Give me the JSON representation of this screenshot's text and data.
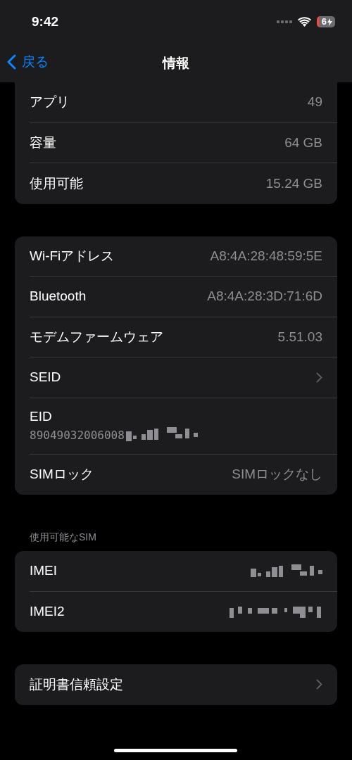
{
  "status_bar": {
    "time": "9:42",
    "battery": "6",
    "charging": true
  },
  "nav": {
    "back": "戻る",
    "title": "情報"
  },
  "groups": [
    {
      "rows": [
        {
          "kind": "value",
          "label": "アプリ",
          "value": "49"
        },
        {
          "kind": "value",
          "label": "容量",
          "value": "64 GB"
        },
        {
          "kind": "value",
          "label": "使用可能",
          "value": "15.24 GB"
        }
      ]
    },
    {
      "rows": [
        {
          "kind": "value",
          "label": "Wi-Fiアドレス",
          "value": "A8:4A:28:48:59:5E"
        },
        {
          "kind": "value",
          "label": "Bluetooth",
          "value": "A8:4A:28:3D:71:6D"
        },
        {
          "kind": "value",
          "label": "モデムファームウェア",
          "value": "5.51.03"
        },
        {
          "kind": "chevron",
          "label": "SEID"
        },
        {
          "kind": "stacked",
          "label": "EID",
          "value": "89049032006008"
        },
        {
          "kind": "value",
          "label": "SIMロック",
          "value": "SIMロックなし"
        }
      ]
    },
    {
      "header": "使用可能なSIM",
      "rows": [
        {
          "kind": "redacted",
          "label": "IMEI"
        },
        {
          "kind": "redacted",
          "label": "IMEI2"
        }
      ]
    },
    {
      "rows": [
        {
          "kind": "chevron",
          "label": "証明書信頼設定"
        }
      ]
    }
  ]
}
